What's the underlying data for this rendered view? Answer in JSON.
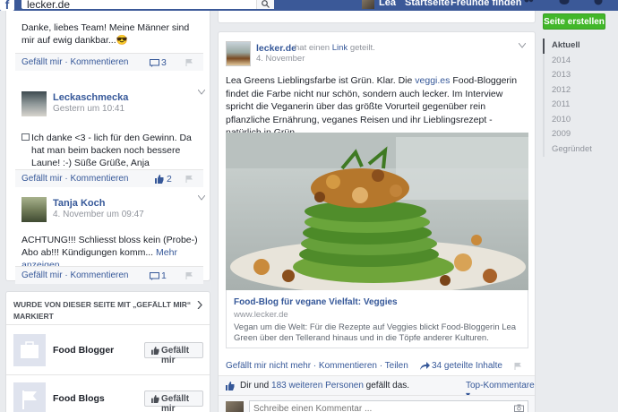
{
  "topbar": {
    "logo": "f",
    "search_value": "lecker.de",
    "user_name": "Lea",
    "home_label": "Startseite",
    "friends_label": "Freunde finden"
  },
  "left_comments": [
    {
      "text": "Danke, liebes Team! Meine Männer sind mir auf ewig dankbar...😎",
      "like_label": "Gefällt mir",
      "comment_label": "Kommentieren",
      "count": "3"
    },
    {
      "name": "Leckaschmecka",
      "date": "Gestern um 10:41",
      "text": "Ich danke <3 - lich für den Gewinn. Da hat man beim backen noch bessere Laune! :-) Süße Grüße, Anja",
      "like_label": "Gefällt mir",
      "comment_label": "Kommentieren",
      "count": "2"
    },
    {
      "name": "Tanja Koch",
      "date": "4. November um 09:47",
      "text": "ACHTUNG!!! Schliesst bloss kein (Probe-) Abo ab!!! Kündigungen komm...",
      "more_label": "Mehr anzeigen",
      "like_label": "Gefällt mir",
      "comment_label": "Kommentieren",
      "count": "1"
    }
  ],
  "liked_pages": {
    "header": "WURDE VON DIESER SEITE MIT „GEFÄLLT MIR“ MARKIERT",
    "items": [
      {
        "name": "Food Blogger",
        "button": "Gefällt mir"
      },
      {
        "name": "Food Blogs",
        "button": "Gefällt mir"
      }
    ]
  },
  "post": {
    "page_name": "lecker.de",
    "action_prefix": "hat einen",
    "action_link": "Link",
    "action_suffix": "geteilt.",
    "date": "4. November",
    "text_1": "Lea Greens Lieblingsfarbe ist Grün. Klar. Die",
    "text_link": "veggi.es",
    "text_2": "Food-Bloggerin findet die Farbe nicht nur schön, sondern auch lecker. Im Interview spricht die Veganerin über das größte Vorurteil gegenüber rein pflanzliche Ernährung, veganes Reisen und ihr Lieblingsrezept - natürlich in Grün.",
    "link_title": "Food-Blog für vegane Vielfalt: Veggies",
    "link_url": "www.lecker.de",
    "link_desc": "Vegan um die Welt: Für die Rezepte auf Veggies blickt Food-Bloggerin Lea Green über den Tellerand hinaus und in die Töpfe anderer Kulturen.",
    "actions": "Gefällt mir nicht mehr · Kommentieren · Teilen",
    "shares": "34 geteilte Inhalte",
    "likes_prefix": "Dir und",
    "likes_link": "183 weiteren Personen",
    "likes_suffix": "gefällt das.",
    "top_comments": "Top-Kommentare ▾",
    "comment_placeholder": "Schreibe einen Kommentar ..."
  },
  "sidebar": {
    "create_page": "Seite erstellen",
    "timeline": [
      "Aktuell",
      "2014",
      "2013",
      "2012",
      "2011",
      "2010",
      "2009",
      "Gegründet"
    ]
  },
  "colors": {
    "fb_blue": "#3b5998",
    "link": "#365899",
    "green_button": "#42b72a"
  }
}
